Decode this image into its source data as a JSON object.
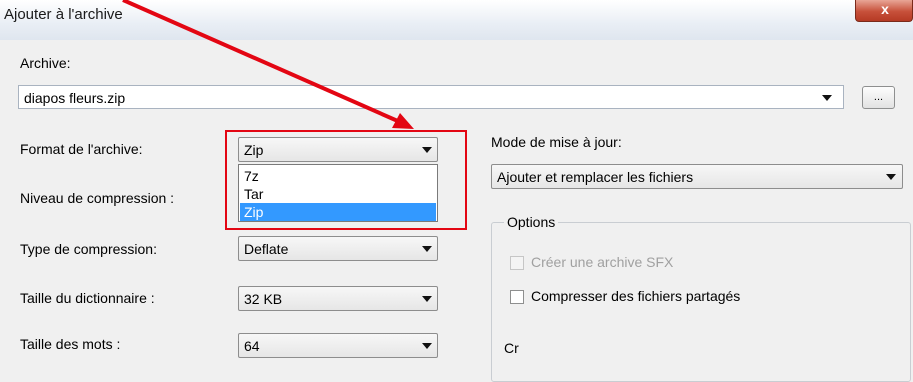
{
  "window": {
    "title": "Ajouter à l'archive",
    "close_glyph": "x"
  },
  "archive": {
    "label": "Archive:",
    "value": "diapos fleurs.zip",
    "browse_label": "..."
  },
  "format": {
    "label": "Format de l'archive:",
    "selected": "Zip",
    "options": [
      "7z",
      "Tar",
      "Zip"
    ],
    "highlighted_option": "Zip"
  },
  "compression_level": {
    "label": "Niveau de compression :"
  },
  "compression_type": {
    "label": "Type de compression:",
    "value": "Deflate"
  },
  "dictionary_size": {
    "label": "Taille du dictionnaire :",
    "value": "32 KB"
  },
  "word_size": {
    "label": "Taille des mots :",
    "value": "64"
  },
  "update_mode": {
    "label": "Mode de mise à jour:",
    "value": "Ajouter et remplacer les fichiers"
  },
  "options": {
    "group_label": "Options",
    "create_sfx": {
      "label": "Créer une archive SFX",
      "checked": false,
      "enabled": false
    },
    "compress_shared": {
      "label": "Compresser des fichiers partagés",
      "checked": false,
      "enabled": true
    }
  },
  "next_group_label_partial": "Cr",
  "colors": {
    "annotation_red": "#e30613",
    "selection_blue": "#3399ff"
  }
}
